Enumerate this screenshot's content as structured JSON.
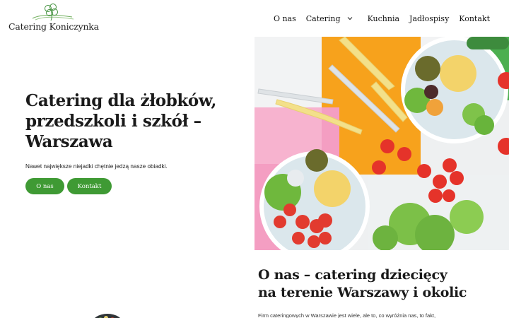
{
  "brand": {
    "name": "Catering Koniczynka"
  },
  "nav": {
    "items": [
      {
        "label": "O nas"
      },
      {
        "label": "Catering"
      },
      {
        "label": "Kuchnia"
      },
      {
        "label": "Jadłospisy"
      },
      {
        "label": "Kontakt"
      }
    ]
  },
  "hero": {
    "title_line1": "Catering dla żłobków,",
    "title_line2": "przedszkoli i szkół –",
    "title_line3": "Warszawa",
    "subtitle": "Nawet największe niejadki chętnie jedzą nasze obiadki.",
    "btn_about": "O nas",
    "btn_contact": "Kontakt"
  },
  "about": {
    "title_line1": "O nas – catering dziecięcy",
    "title_line2": "na terenie Warszawy i okolic",
    "text": "Firm cateringowych w Warszawie jest wiele, ale to, co wyróżnia nas, to fakt,"
  },
  "colors": {
    "accent": "#3f9a34",
    "text": "#1a1a1a",
    "bg": "#ffffff"
  },
  "icons": {
    "logo": "clover-logo-icon",
    "dropdown": "chevron-down-icon"
  }
}
